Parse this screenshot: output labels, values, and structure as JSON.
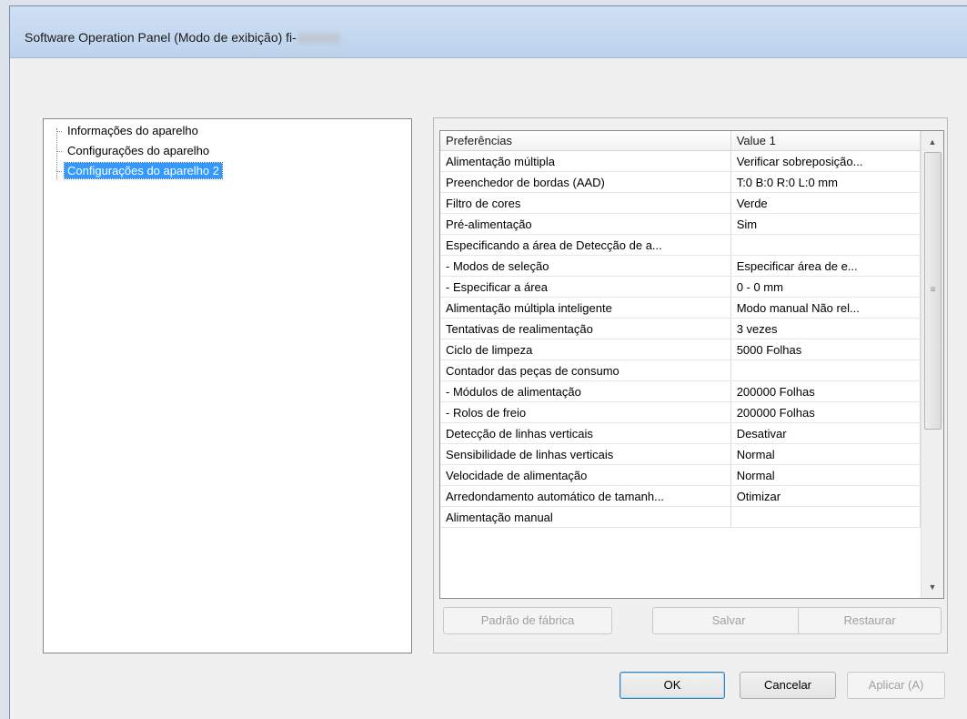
{
  "window": {
    "title": "Software Operation Panel (Modo de exibição) fi-"
  },
  "tree": {
    "items": [
      {
        "label": "Informações do aparelho",
        "selected": false
      },
      {
        "label": "Configurações do aparelho",
        "selected": false
      },
      {
        "label": "Configurações do aparelho 2",
        "selected": true
      }
    ]
  },
  "grid": {
    "headers": [
      "Preferências",
      "Value 1"
    ],
    "rows": [
      [
        "Alimentação múltipla",
        "Verificar sobreposição..."
      ],
      [
        "Preenchedor de bordas (AAD)",
        "T:0  B:0  R:0  L:0 mm"
      ],
      [
        "Filtro de cores",
        "Verde"
      ],
      [
        "Pré-alimentação",
        "Sim"
      ],
      [
        "Especificando a área de Detecção de a...",
        ""
      ],
      [
        " - Modos de seleção",
        "Especificar área de e..."
      ],
      [
        " - Especificar a área",
        "0 - 0 mm"
      ],
      [
        "Alimentação múltipla inteligente",
        "Modo manual  Não rel..."
      ],
      [
        "Tentativas de realimentação",
        "3 vezes"
      ],
      [
        "Ciclo de limpeza",
        "5000 Folhas"
      ],
      [
        "Contador das peças de consumo",
        ""
      ],
      [
        " - Módulos de alimentação",
        "200000 Folhas"
      ],
      [
        " - Rolos de freio",
        "200000 Folhas"
      ],
      [
        "Detecção de linhas verticais",
        "Desativar"
      ],
      [
        "Sensibilidade de linhas verticais",
        "Normal"
      ],
      [
        "Velocidade de alimentação",
        "Normal"
      ],
      [
        "Arredondamento automático de tamanh...",
        "Otimizar"
      ],
      [
        "Alimentação manual",
        ""
      ]
    ]
  },
  "scrollbar": {
    "up_icon": "▲",
    "down_icon": "▼",
    "grip_icon": "≡"
  },
  "group_buttons": {
    "factory_default": "Padrão de fábrica",
    "save": "Salvar",
    "restore": "Restaurar"
  },
  "dialog_buttons": {
    "ok": "OK",
    "cancel": "Cancelar",
    "apply": "Aplicar (A)"
  }
}
